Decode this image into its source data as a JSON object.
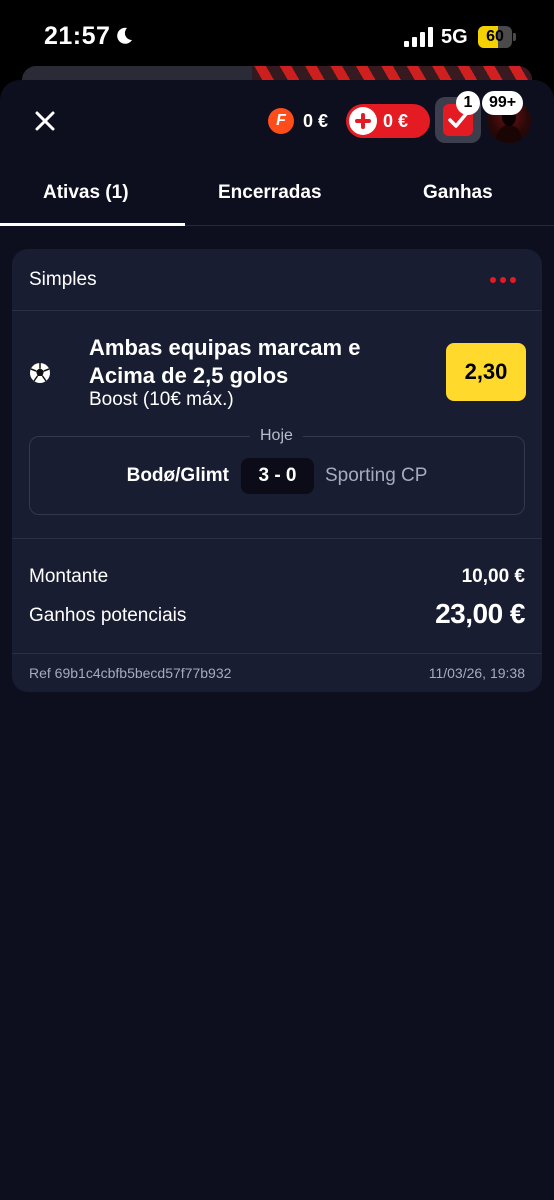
{
  "status_bar": {
    "time": "21:57",
    "network": "5G",
    "battery_percent": "60",
    "battery_level": 0.6
  },
  "header": {
    "freebet_icon_letter": "F",
    "freebet_amount": "0 €",
    "deposit_amount": "0 €",
    "betslip_count": "1",
    "notifications_count": "99+"
  },
  "tabs": [
    {
      "label": "Ativas (1)",
      "active": true
    },
    {
      "label": "Encerradas",
      "active": false
    },
    {
      "label": "Ganhas",
      "active": false
    }
  ],
  "bet": {
    "type_label": "Simples",
    "market_line1": "Ambas equipas marcam e",
    "market_line2": "Acima de 2,5 golos",
    "market_sub": "Boost (10€ máx.)",
    "odds": "2,30",
    "event_date": "Hoje",
    "home_team": "Bodø/Glimt",
    "score": "3 - 0",
    "away_team": "Sporting CP",
    "stake_label": "Montante",
    "stake_value": "10,00 €",
    "payout_label": "Ganhos potenciais",
    "payout_value": "23,00 €",
    "ref": "Ref 69b1c4cbfb5becd57f77b932",
    "placed_at": "11/03/26, 19:38"
  },
  "colors": {
    "accent_red": "#e41b23",
    "odds_yellow": "#ffd92b",
    "card_bg": "#191d31",
    "sheet_bg": "#0d0f1f"
  },
  "icons": [
    "moon-icon",
    "signal-icon",
    "close-icon",
    "freebet-icon",
    "plus-icon",
    "checkmark-icon",
    "more-icon",
    "soccer-ball-icon"
  ]
}
